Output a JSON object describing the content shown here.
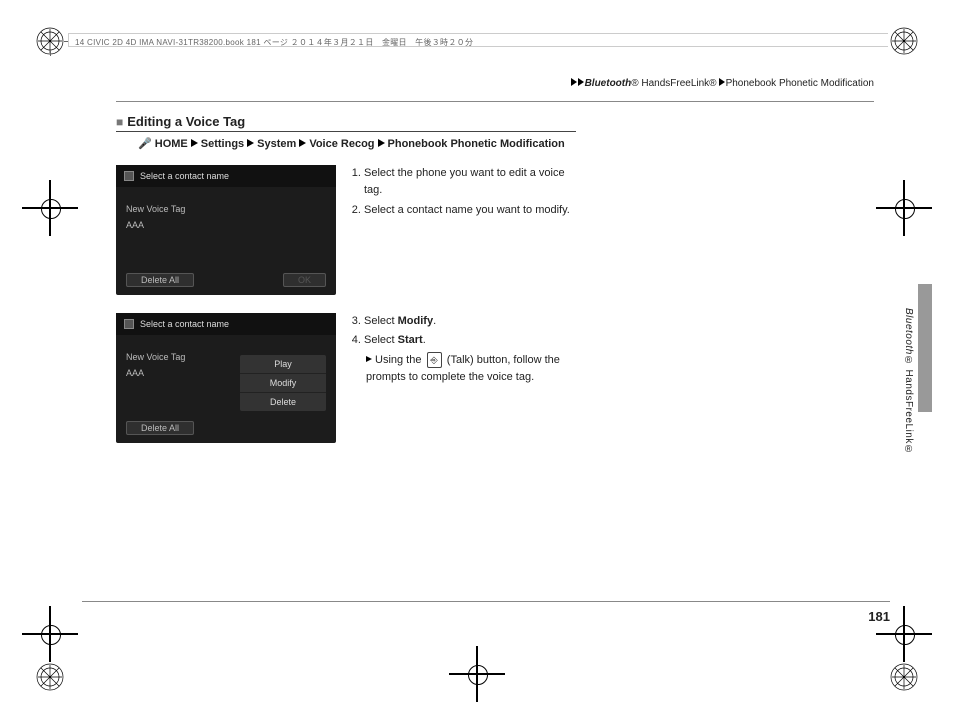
{
  "doc_header": "14 CIVIC 2D 4D IMA NAVI-31TR38200.book  181 ページ  ２０１４年３月２１日　金曜日　午後３時２０分",
  "breadcrumb": {
    "part1_italic": "Bluetooth",
    "part1_sym": "®",
    "part1_rest": " HandsFreeLink®",
    "part2": "Phonebook Phonetic Modification"
  },
  "section": {
    "title": "Editing a Voice Tag",
    "nav": {
      "home": "HOME",
      "settings": "Settings",
      "system": "System",
      "voice": "Voice Recog",
      "phonetic": "Phonebook Phonetic Modification"
    }
  },
  "screenshots": {
    "header": "Select a contact name",
    "line1": "New Voice Tag",
    "line2": "AAA",
    "delete_all": "Delete All",
    "ok": "OK",
    "popup": {
      "play": "Play",
      "modify": "Modify",
      "delete": "Delete"
    }
  },
  "steps_a": {
    "s1": "Select the phone you want to edit a voice tag.",
    "s2": "Select a contact name you want to modify."
  },
  "steps_b": {
    "s3_pre": "Select ",
    "s3_bold": "Modify",
    "s3_post": ".",
    "s4_pre": "Select ",
    "s4_bold": "Start",
    "s4_post": ".",
    "sub_pre": "Using the ",
    "talk_icon": "⎆",
    "sub_mid": " (Talk) button, follow the prompts to complete the voice tag."
  },
  "side": {
    "italic": "Bluetooth",
    "rest": "® HandsFreeLink®"
  },
  "page_number": "181"
}
